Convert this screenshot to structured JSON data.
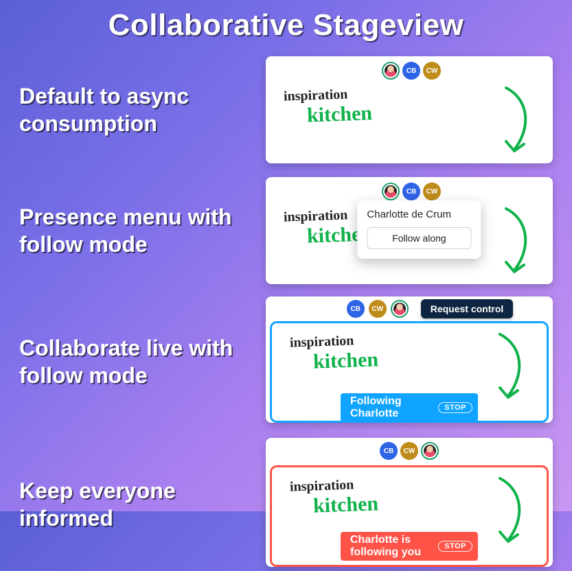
{
  "title": "Collaborative Stageview",
  "rows": [
    {
      "label": "Default to async consumption"
    },
    {
      "label": "Presence menu with follow mode"
    },
    {
      "label": "Collaborate live with follow mode"
    },
    {
      "label": "Keep everyone informed"
    }
  ],
  "board": {
    "word_top": "inspiration",
    "word_main": "kitchen"
  },
  "avatars": {
    "cb": "CB",
    "cw": "CW"
  },
  "popover": {
    "name": "Charlotte de Crum",
    "button": "Follow along"
  },
  "request_control": "Request control",
  "status": {
    "following": "Following Charlotte",
    "being_followed": "Charlotte is following you",
    "stop": "STOP"
  }
}
